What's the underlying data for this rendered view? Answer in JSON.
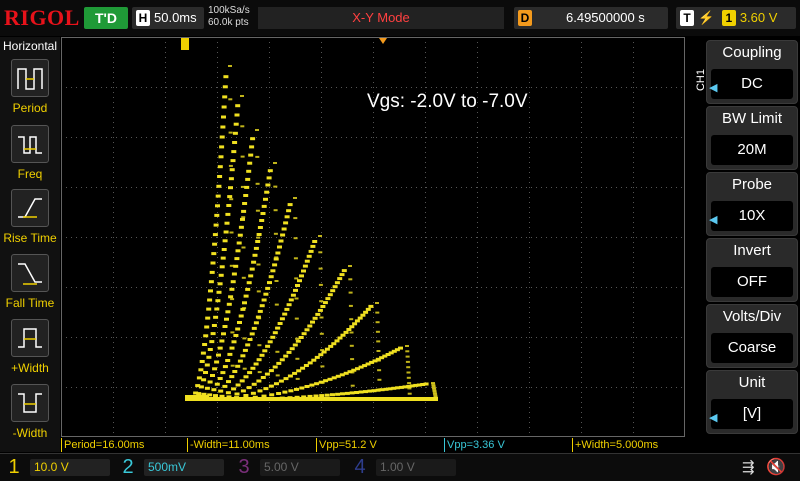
{
  "brand": "RIGOL",
  "trigger_status": "T'D",
  "timebase": {
    "tag": "H",
    "value": "50.0ms"
  },
  "sample": {
    "rate": "100kSa/s",
    "points": "60.0k pts"
  },
  "mode_label": "X-Y Mode",
  "delay": {
    "tag": "D",
    "value": "6.49500000 s"
  },
  "trigger": {
    "tag": "T",
    "source": "1",
    "level": "3.60 V"
  },
  "left_panel": {
    "title": "Horizontal",
    "items": [
      {
        "label": "Period",
        "icon": "period-icon"
      },
      {
        "label": "Freq",
        "icon": "frequency-icon"
      },
      {
        "label": "Rise Time",
        "icon": "rise-time-icon"
      },
      {
        "label": "Fall Time",
        "icon": "fall-time-icon"
      },
      {
        "label": "+Width",
        "icon": "positive-width-icon"
      },
      {
        "label": "-Width",
        "icon": "negative-width-icon"
      }
    ]
  },
  "annotation": "Vgs: -2.0V to -7.0V",
  "measurements": [
    {
      "text": "Period=16.00ms",
      "color": "#f0d000"
    },
    {
      "text": "-Width=11.00ms",
      "color": "#f0d000"
    },
    {
      "text": "Vpp=51.2 V",
      "color": "#f0d000"
    },
    {
      "text": "Vpp=3.36 V",
      "color": "#39c8d8"
    },
    {
      "text": "+Width=5.000ms",
      "color": "#f0d000"
    }
  ],
  "right_panel": {
    "channel_tag": "CH1",
    "items": [
      {
        "title": "Coupling",
        "value": "DC"
      },
      {
        "title": "BW Limit",
        "value": "20M"
      },
      {
        "title": "Probe",
        "value": "10X"
      },
      {
        "title": "Invert",
        "value": "OFF"
      },
      {
        "title": "Volts/Div",
        "value": "Coarse"
      },
      {
        "title": "Unit",
        "value": "[V]"
      }
    ]
  },
  "channels": [
    {
      "num": "1",
      "scale": "10.0 V",
      "color": "#f0d000",
      "active": true
    },
    {
      "num": "2",
      "scale": "500mV",
      "color": "#39c8d8",
      "active": true
    },
    {
      "num": "3",
      "scale": "5.00 V",
      "color": "#c040c0",
      "active": false
    },
    {
      "num": "4",
      "scale": "1.00 V",
      "color": "#4060e0",
      "active": false
    }
  ],
  "colors": {
    "trace": "#f0e020",
    "grid": "#444444",
    "accent": "#e8121a"
  }
}
